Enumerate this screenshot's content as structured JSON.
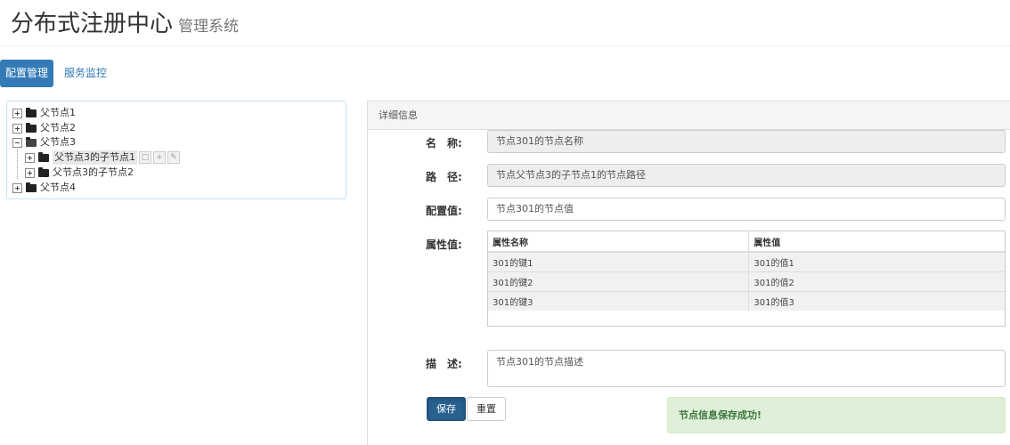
{
  "app": {
    "title": "分布式注册中心",
    "subtitle": "管理系统"
  },
  "nav": {
    "tabs": [
      {
        "label": "配置管理"
      },
      {
        "label": "服务监控"
      }
    ]
  },
  "tree": {
    "nodes": [
      {
        "label": "父节点1"
      },
      {
        "label": "父节点2"
      },
      {
        "label": "父节点3"
      },
      {
        "label": "父节点3的子节点1"
      },
      {
        "label": "父节点3的子节点2"
      },
      {
        "label": "父节点4"
      }
    ]
  },
  "panel": {
    "title": "详细信息",
    "name_label": "名　称:",
    "name_value": "节点301的节点名称",
    "path_label": "路　径:",
    "path_value": "节点父节点3的子节点1的节点路径",
    "config_label": "配置值:",
    "config_value": "节点301的节点值",
    "attr_label": "属性值:",
    "attr_headers": [
      "属性名称",
      "属性值"
    ],
    "attr_rows": [
      [
        "301的键1",
        "301的值1"
      ],
      [
        "301的键2",
        "301的值2"
      ],
      [
        "301的键3",
        "301的值3"
      ]
    ],
    "desc_label": "描　述:",
    "desc_value": "节点301的节点描述",
    "save_label": "保存",
    "reset_label": "重置",
    "alert": "节点信息保存成功!"
  },
  "colors": {
    "accent": "#337ab7",
    "primary_button": "#286090",
    "success_bg": "#dff0d8",
    "success_text": "#3c763d"
  }
}
